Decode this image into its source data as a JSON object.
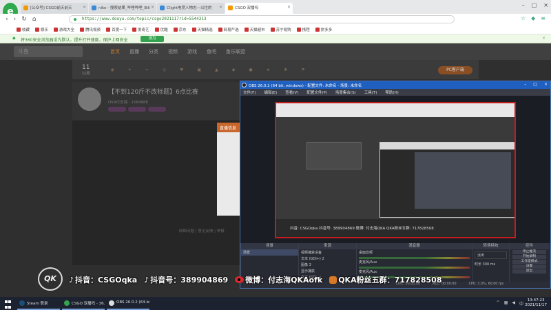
{
  "browser": {
    "tabs": [
      {
        "label": "[公众号] CSGO前天前天"
      },
      {
        "label": "nike - 搜索结果_哔哩哔哩_Bili"
      },
      {
        "label": "Clight电竞人物志—以往的"
      },
      {
        "label": "CSGO 双播吗",
        "active": true
      }
    ],
    "url": "https://www.douyu.com/topic/csgo2021117rid=5544313",
    "bookmarks": [
      "收藏",
      "娱乐",
      "游戏大全",
      "腾讯视频",
      "百度一下",
      "爱奇艺",
      "优酷",
      "京东",
      "天猫精选",
      "网易严选",
      "天猫超市",
      "苏宁易购",
      "携程",
      "拼多多"
    ],
    "notice": "将360安全浏览器设为默认，提升打开速度，保护上网安全",
    "notice_button": "设为"
  },
  "douyu": {
    "nav": [
      "首页",
      "直播",
      "分类",
      "视频",
      "游戏",
      "鱼吧",
      "鱼乐联盟"
    ],
    "date_day": "11",
    "date_month": "11月",
    "pc_button": "PC客户端",
    "room_title": "【不到120斤不改标题】6点比赛",
    "room_meta": "OKA付志海 · 1584888",
    "dialog_title": "直播信息",
    "footer": "网络问题 | 意见反馈 | 举报"
  },
  "obs": {
    "title": "OBS 26.0.2 (64 bit, windows) - 配置文件: 未命名 - 场景: 未命名",
    "menu": [
      "文件(F)",
      "编辑(E)",
      "查看(V)",
      "配置文件(P)",
      "场景集合(S)",
      "工具(T)",
      "帮助(H)"
    ],
    "preview_bottom": "抖音: CSGOqka   抖音号: 389904869   微博: 付志海QKA   QKA粉丝五群: 717828508",
    "docks": {
      "scenes": {
        "title": "场景",
        "items": [
          "场景"
        ]
      },
      "sources": {
        "title": "来源",
        "items": [
          "视频捕获设备",
          "文本 (GDI+) 2",
          "图像 3",
          "显示捕获",
          "文本 (GDI+)",
          "图像"
        ]
      },
      "mixer": {
        "title": "混音器",
        "items": [
          "桌面音频",
          "麦克风/Aux",
          "麦克风/Aux"
        ]
      },
      "transitions": {
        "title": "转场特效",
        "fade": "淡出",
        "duration_label": "时长",
        "duration": "300 ms"
      },
      "controls": {
        "title": "控件",
        "buttons": [
          "停止推流",
          "开始录制",
          "工作室模式",
          "设置",
          "退出"
        ]
      }
    },
    "status": {
      "live": "LIVE: 00:00:00",
      "rec": "REC: 00:00:00",
      "cpu": "CPU: 3.0%, 60.00 fps"
    }
  },
  "overlay": {
    "douyin_label": "抖音：CSGOqka",
    "douyin_id_label": "抖音号：389904869",
    "weibo_label": "微博：付志海QKAofk",
    "qq_group_label": "QKA粉丝五群：717828508",
    "logo_text": "QK"
  },
  "taskbar": {
    "items": [
      "Steam 登录",
      "CSGO 双播吗 - 36...",
      "OBS 26.0.2 (64-bi..."
    ],
    "time": "13:47:23",
    "date": "2021/11/17"
  }
}
